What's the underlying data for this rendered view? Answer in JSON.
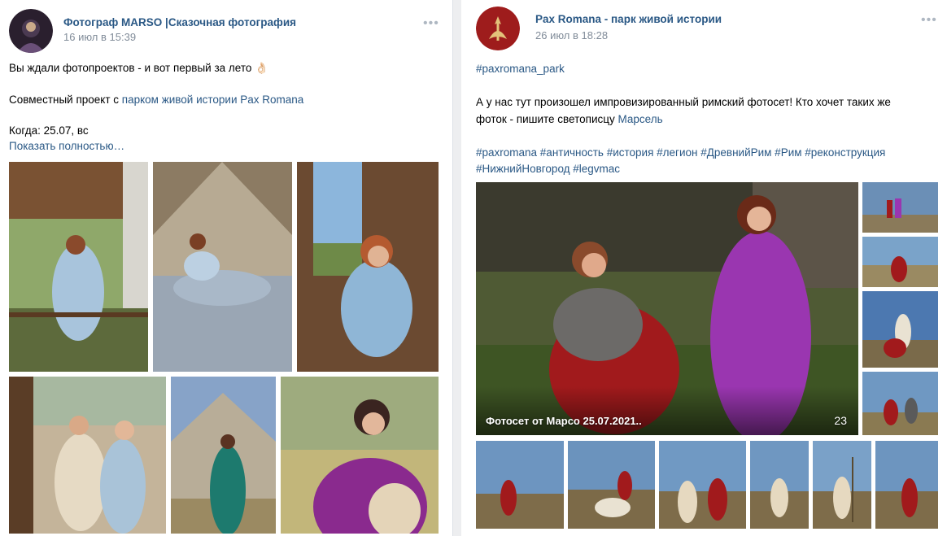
{
  "post_left": {
    "author": "Фотограф MARSO |Сказочная фотография",
    "date": "16 июл в 15:39",
    "more": "•••",
    "line1": "Вы ждали фотопроектов - и вот первый за лето",
    "emoji": "👌🏻",
    "line2_prefix": "Совместный проект с ",
    "line2_link": "парком живой истории Pax Romana",
    "line3": "Когда: 25.07, вс",
    "show_more": "Показать полностью…",
    "photos": [
      "photo-1",
      "photo-2",
      "photo-3",
      "photo-4",
      "photo-5",
      "photo-6"
    ]
  },
  "post_right": {
    "author": "Pax Romana - парк живой истории",
    "date": "26 июл в 18:28",
    "more": "•••",
    "hashtag_top": "#paxromana_park",
    "body_line1": "А у нас тут произошел импровизированный римский фотосет! Кто хочет таких же",
    "body_line2_prefix": "фоток - пишите светописцу ",
    "body_line2_link": "Марсель",
    "hashtags_line1": "#paxromana #античность #история #легион #ДревнийРим #Рим #реконструкция",
    "hashtags_line2": "#НижнийНовгород #legvmac",
    "album_title": "Фотосет от Марсо 25.07.2021..",
    "album_count": "23"
  },
  "colors": {
    "link": "#2a5885",
    "meta": "#818c99",
    "background": "#edeef0"
  }
}
